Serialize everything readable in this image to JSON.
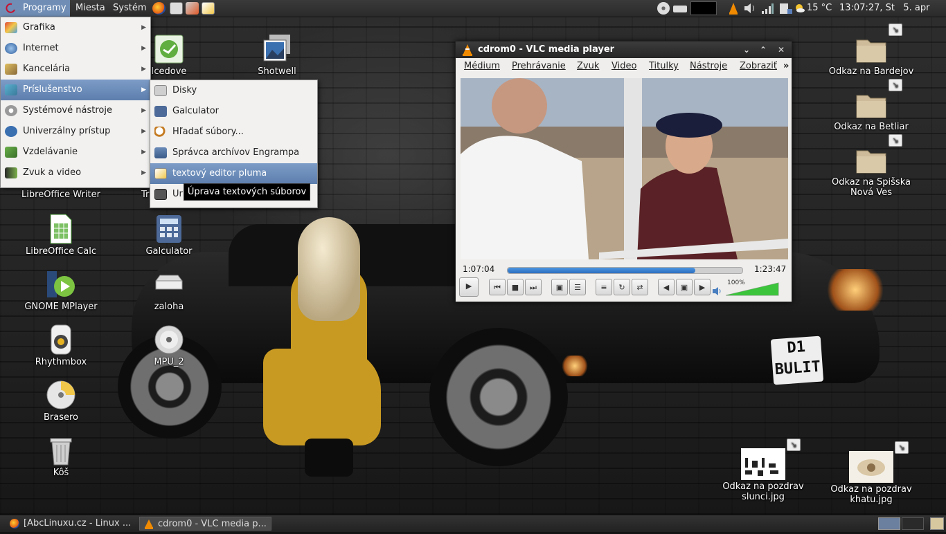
{
  "top_panel": {
    "menus": [
      "Programy",
      "Miesta",
      "Systém"
    ],
    "temperature": "15 °C",
    "clock": "13:07:27, St   5. apr"
  },
  "app_menu": {
    "items": [
      {
        "label": "Grafika",
        "icon": "graphics-icon"
      },
      {
        "label": "Internet",
        "icon": "globe-icon"
      },
      {
        "label": "Kancelária",
        "icon": "office-icon"
      },
      {
        "label": "Príslušenstvo",
        "icon": "accessories-icon",
        "selected": true
      },
      {
        "label": "Systémové nástroje",
        "icon": "system-tools-icon"
      },
      {
        "label": "Univerzálny prístup",
        "icon": "accessibility-icon"
      },
      {
        "label": "Vzdelávanie",
        "icon": "education-icon"
      },
      {
        "label": "Zvuk a video",
        "icon": "multimedia-icon"
      }
    ],
    "submenu": [
      {
        "label": "Disky",
        "icon": "disks-icon"
      },
      {
        "label": "Galculator",
        "icon": "calculator-icon"
      },
      {
        "label": "Hľadať súbory...",
        "icon": "search-icon"
      },
      {
        "label": "Správca archívov Engrampa",
        "icon": "archive-icon"
      },
      {
        "label": "textový editor pluma",
        "icon": "text-editor-icon",
        "selected": true
      },
      {
        "label": "Ur",
        "icon": "screenshot-icon"
      }
    ],
    "tooltip": "Úprava textových súborov"
  },
  "desktop_icons_left": [
    {
      "label": "Icedove",
      "icon": "icedove-icon"
    },
    {
      "label": "Shotwell",
      "icon": "shotwell-icon"
    },
    {
      "label": "LibreOffice Writer",
      "icon": "writer-icon"
    },
    {
      "label": "Tr",
      "icon": "transmission-icon"
    },
    {
      "label": "LibreOffice Calc",
      "icon": "calc-icon"
    },
    {
      "label": "Galculator",
      "icon": "calculator-icon"
    },
    {
      "label": "GNOME MPlayer",
      "icon": "mplayer-icon"
    },
    {
      "label": "zaloha",
      "icon": "drive-icon"
    },
    {
      "label": "Rhythmbox",
      "icon": "rhythmbox-icon"
    },
    {
      "label": "MPU_2",
      "icon": "cd-icon"
    },
    {
      "label": "Brasero",
      "icon": "brasero-icon"
    },
    {
      "label": "Kôš",
      "icon": "trash-icon"
    }
  ],
  "desktop_icons_right": [
    {
      "label": "Odkaz na Bardejov",
      "icon": "folder-link-icon"
    },
    {
      "label": "Odkaz na Betliar",
      "icon": "folder-link-icon"
    },
    {
      "label": "Odkaz na Spišska Nová Ves",
      "icon": "folder-link-icon"
    },
    {
      "label": "Odkaz na pozdrav slunci.jpg",
      "icon": "image-link-icon"
    },
    {
      "label": "Odkaz na pozdrav khatu.jpg",
      "icon": "image-link-icon"
    }
  ],
  "vlc": {
    "title": "cdrom0 - VLC media player",
    "menu": [
      "Médium",
      "Prehrávanie",
      "Zvuk",
      "Video",
      "Titulky",
      "Nástroje",
      "Zobraziť"
    ],
    "elapsed": "1:07:04",
    "total": "1:23:47",
    "progress_fraction": 0.8,
    "volume": "100%",
    "volume_fraction": 1.0
  },
  "taskbar": {
    "tasks": [
      "[AbcLinuxu.cz - Linux ...",
      "cdrom0 - VLC media p..."
    ]
  },
  "wallpaper_plate": [
    "D1",
    "BULIT"
  ]
}
